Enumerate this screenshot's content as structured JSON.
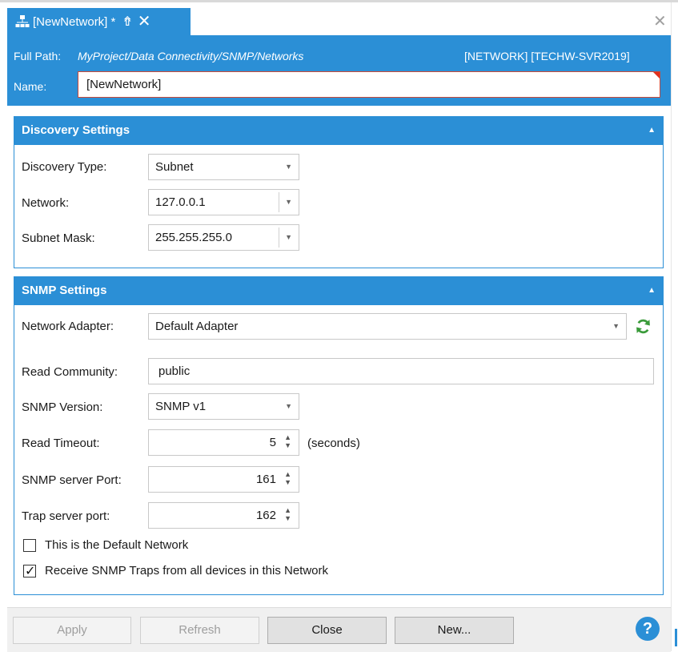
{
  "tab": {
    "title": "[NewNetwork] *",
    "pin_icon": "pin-up-icon",
    "close_icon": "close-icon"
  },
  "header": {
    "full_path_label": "Full Path:",
    "full_path_value": "MyProject/Data Connectivity/SNMP/Networks",
    "right_info": "[NETWORK] [TECHW-SVR2019]",
    "name_label": "Name:",
    "name_value": "[NewNetwork]"
  },
  "discovery": {
    "title": "Discovery Settings",
    "type_label": "Discovery Type:",
    "type_value": "Subnet",
    "network_label": "Network:",
    "network_value": "127.0.0.1",
    "mask_label": "Subnet Mask:",
    "mask_value": "255.255.255.0"
  },
  "snmp": {
    "title": "SNMP Settings",
    "adapter_label": "Network Adapter:",
    "adapter_value": "Default Adapter",
    "community_label": "Read Community:",
    "community_value": "public",
    "version_label": "SNMP Version:",
    "version_value": "SNMP v1",
    "timeout_label": "Read Timeout:",
    "timeout_value": "5",
    "timeout_unit": "(seconds)",
    "port_label": "SNMP server Port:",
    "port_value": "161",
    "trap_label": "Trap server port:",
    "trap_value": "162",
    "default_network_label": "This is the Default Network",
    "receive_traps_label": "Receive SNMP Traps from all devices in this Network"
  },
  "buttons": {
    "apply": "Apply",
    "refresh": "Refresh",
    "close": "Close",
    "new": "New...",
    "help": "?"
  },
  "colors": {
    "accent": "#2b8fd6",
    "error_border": "#c94a3a",
    "refresh_icon": "#3a9b3a"
  }
}
